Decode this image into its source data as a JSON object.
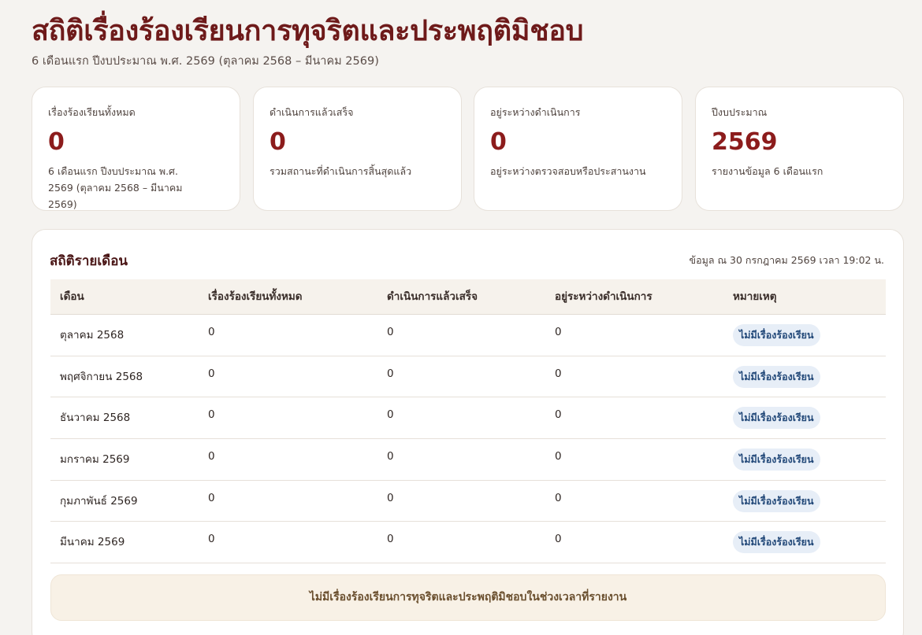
{
  "header": {
    "title": "สถิติเรื่องร้องเรียนการทุจริตและประพฤติมิชอบ",
    "subtitle": "6 เดือนแรก ปีงบประมาณ พ.ศ. 2569 (ตุลาคม 2568 – มีนาคม 2569)"
  },
  "cards": [
    {
      "label": "เรื่องร้องเรียนทั้งหมด",
      "value": "0",
      "note": "6 เดือนแรก ปีงบประมาณ พ.ศ. 2569 (ตุลาคม 2568 – มีนาคม 2569)"
    },
    {
      "label": "ดำเนินการแล้วเสร็จ",
      "value": "0",
      "note": "รวมสถานะที่ดำเนินการสิ้นสุดแล้ว"
    },
    {
      "label": "อยู่ระหว่างดำเนินการ",
      "value": "0",
      "note": "อยู่ระหว่างตรวจสอบหรือประสานงาน"
    },
    {
      "label": "ปีงบประมาณ",
      "value": "2569",
      "note": "รายงานข้อมูล 6 เดือนแรก"
    }
  ],
  "monthly": {
    "title": "สถิติรายเดือน",
    "updated": "ข้อมูล ณ 30 กรกฎาคม 2569 เวลา 19:02 น.",
    "columns": [
      "เดือน",
      "เรื่องร้องเรียนทั้งหมด",
      "ดำเนินการแล้วเสร็จ",
      "อยู่ระหว่างดำเนินการ",
      "หมายเหตุ"
    ],
    "rows": [
      {
        "month": "ตุลาคม 2568",
        "total": "0",
        "done": "0",
        "pending": "0",
        "note": "ไม่มีเรื่องร้องเรียน"
      },
      {
        "month": "พฤศจิกายน 2568",
        "total": "0",
        "done": "0",
        "pending": "0",
        "note": "ไม่มีเรื่องร้องเรียน"
      },
      {
        "month": "ธันวาคม 2568",
        "total": "0",
        "done": "0",
        "pending": "0",
        "note": "ไม่มีเรื่องร้องเรียน"
      },
      {
        "month": "มกราคม 2569",
        "total": "0",
        "done": "0",
        "pending": "0",
        "note": "ไม่มีเรื่องร้องเรียน"
      },
      {
        "month": "กุมภาพันธ์ 2569",
        "total": "0",
        "done": "0",
        "pending": "0",
        "note": "ไม่มีเรื่องร้องเรียน"
      },
      {
        "month": "มีนาคม 2569",
        "total": "0",
        "done": "0",
        "pending": "0",
        "note": "ไม่มีเรื่องร้องเรียน"
      }
    ],
    "empty_message": "ไม่มีเรื่องร้องเรียนการทุจริตและประพฤติมิชอบในช่วงเวลาที่รายงาน"
  },
  "colors": {
    "title": "#6e1a1a",
    "value": "#8c1c1c",
    "background": "#f5f3f0",
    "badge_bg": "#e7eef7",
    "badge_text": "#244a7a",
    "banner_bg": "#f8f1e6"
  }
}
